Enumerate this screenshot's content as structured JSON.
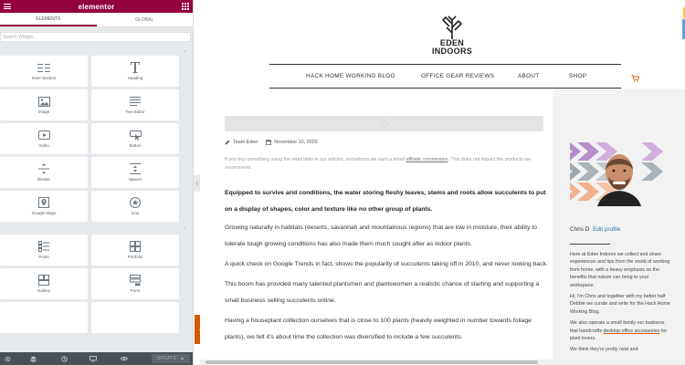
{
  "panel": {
    "brand": "elementor",
    "tabs": [
      {
        "label": "ELEMENTS"
      },
      {
        "label": "GLOBAL"
      }
    ],
    "search_placeholder": "Search Widget...",
    "basic_widgets": [
      {
        "label": "Inner Section",
        "icon": "inner-section-icon"
      },
      {
        "label": "Heading",
        "icon": "heading-icon"
      },
      {
        "label": "Image",
        "icon": "image-icon"
      },
      {
        "label": "Text Editor",
        "icon": "text-editor-icon"
      },
      {
        "label": "Video",
        "icon": "video-icon"
      },
      {
        "label": "Button",
        "icon": "button-icon"
      },
      {
        "label": "Divider",
        "icon": "divider-icon"
      },
      {
        "label": "Spacer",
        "icon": "spacer-icon"
      },
      {
        "label": "Google Maps",
        "icon": "google-maps-icon"
      },
      {
        "label": "Icon",
        "icon": "star-icon"
      }
    ],
    "pro_widgets": [
      {
        "label": "Posts",
        "icon": "posts-icon"
      },
      {
        "label": "Portfolio",
        "icon": "portfolio-icon"
      },
      {
        "label": "Gallery",
        "icon": "gallery-icon"
      },
      {
        "label": "Form",
        "icon": "form-icon"
      }
    ],
    "update_label": "UPDATE",
    "accent_color": "#93003c"
  },
  "site": {
    "logo_line1": "EDEN",
    "logo_line2": "INDOORS",
    "nav": [
      {
        "label": "HACK HOME WORKING BLOG"
      },
      {
        "label": "OFFICE GEAR REVIEWS"
      },
      {
        "label": "ABOUT"
      },
      {
        "label": "SHOP"
      }
    ],
    "post": {
      "author": "Team Eden",
      "date": "November 10, 2020",
      "disclaimer_pre": "If you buy something using the retail links in our articles, sometimes we earn a small ",
      "disclaimer_link": "affiliate commission",
      "disclaimer_post": ". This does not impact the products we recommend.",
      "lead": "Equipped to survive arid conditions, the water storing fleshy leaves, stems and roots allow succulents to put on a display of shapes, color and texture like no other group of plants.",
      "paragraphs": [
        "Growing naturally in habitats (deserts, savannah and mountainous regions) that are low in moisture, their ability to tolerate tough growing conditions has also made them much sought after as indoor plants.",
        "A quick check on Google Trends in fact, shows the popularity of succulents taking off in 2010, and never looking back.",
        "This boom has provided many talented plantsmen and plantswomen a realistic chance of starting and supporting a small business selling succulents online.",
        "Having a houseplant collection ourselves that is close to 100 plants (heavily weighted in number towards foliage plants), we felt it’s about time the collection was diversified to include a few succulents."
      ]
    },
    "sidebar": {
      "name": "Chris D",
      "edit_label": "Edit profile",
      "bio1": "Here at Eden Indoors we collect and share experiences and tips from the world of working from home, with a heavy emphasis on the benefits that nature can bring to your workspace.",
      "bio2": "Hi, I'm Chris and together with my better half Debbie we curate and write for the Hack Home Working Blog.",
      "bio3_pre": "We also operate a small family run business that handcrafts ",
      "bio3_link": "desktop office accessories",
      "bio3_post": " for plant lovers.",
      "bio4": "We think they're pretty neat and"
    }
  }
}
